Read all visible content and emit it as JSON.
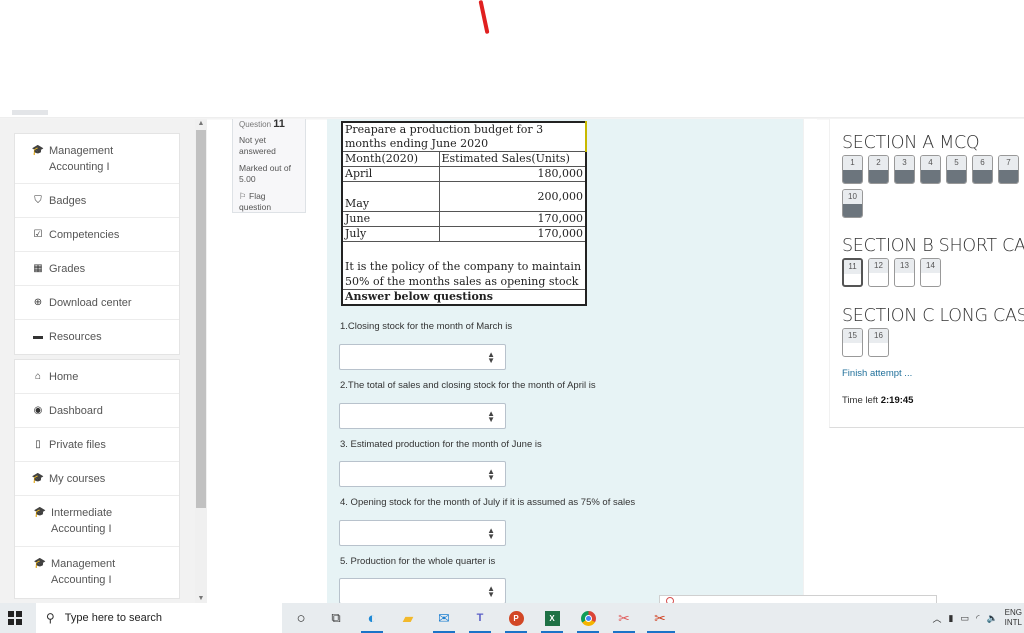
{
  "drawer": {
    "course_group": [
      {
        "icon": "graduation-cap-icon",
        "glyph": "🎓",
        "label": "Management Accounting I"
      },
      {
        "icon": "shield-icon",
        "glyph": "⛉",
        "label": "Badges"
      },
      {
        "icon": "checkbox-icon",
        "glyph": "☑",
        "label": "Competencies"
      },
      {
        "icon": "table-icon",
        "glyph": "▦",
        "label": "Grades"
      },
      {
        "icon": "download-icon",
        "glyph": "⊕",
        "label": "Download center"
      },
      {
        "icon": "archive-icon",
        "glyph": "▬",
        "label": "Resources"
      }
    ],
    "site_group": [
      {
        "icon": "home-icon",
        "glyph": "⌂",
        "label": "Home"
      },
      {
        "icon": "dashboard-icon",
        "glyph": "◉",
        "label": "Dashboard"
      },
      {
        "icon": "file-icon",
        "glyph": "▯",
        "label": "Private files"
      },
      {
        "icon": "graduation-cap-icon",
        "glyph": "🎓",
        "label": "My courses"
      },
      {
        "icon": "graduation-cap-icon",
        "glyph": "🎓",
        "label": "Intermediate Accounting I"
      },
      {
        "icon": "graduation-cap-icon",
        "glyph": "🎓",
        "label": "Management Accounting I"
      }
    ]
  },
  "question_info": {
    "question_label": "Question",
    "question_number": "11",
    "state": "Not yet answered",
    "marked_out_of": "Marked out of 5.00",
    "flag_label": "Flag question"
  },
  "budget_table": {
    "title": "Preapare a production budget for 3 months ending June 2020",
    "header_month": "Month(2020)",
    "header_sales": "Estimated Sales(Units)",
    "rows": [
      {
        "month": "April",
        "sales": "180,000"
      },
      {
        "month": "May",
        "sales": "200,000"
      },
      {
        "month": "June",
        "sales": "170,000"
      },
      {
        "month": "July",
        "sales": "170,000"
      }
    ],
    "policy": "It is the policy of the company to maintain 50% of the months sales as opening stock",
    "instruction": "Answer below questions"
  },
  "questions": [
    {
      "text": "1.Closing stock  for the month of March is",
      "selected": ""
    },
    {
      "text": "2.The total of sales and closing stock for the month of April is",
      "selected": ""
    },
    {
      "text": "3. Estimated production for the month of June is",
      "selected": ""
    },
    {
      "text": "4. Opening stock for the month of July if it is assumed as 75% of sales",
      "selected": ""
    },
    {
      "text": "5. Production for the whole quarter is",
      "selected": ""
    }
  ],
  "quiz_nav": {
    "sections": [
      {
        "title": "SECTION A MCQ",
        "questions": [
          {
            "n": "1",
            "answered": true
          },
          {
            "n": "2",
            "answered": true
          },
          {
            "n": "3",
            "answered": true
          },
          {
            "n": "4",
            "answered": true
          },
          {
            "n": "5",
            "answered": true
          },
          {
            "n": "6",
            "answered": true
          },
          {
            "n": "7",
            "answered": true
          },
          {
            "n": "10",
            "answered": true
          }
        ]
      },
      {
        "title": "SECTION B SHORT CAS",
        "questions": [
          {
            "n": "11",
            "answered": false,
            "current": true
          },
          {
            "n": "12",
            "answered": false
          },
          {
            "n": "13",
            "answered": false
          },
          {
            "n": "14",
            "answered": false
          }
        ]
      },
      {
        "title": "SECTION C LONG CAS",
        "questions": [
          {
            "n": "15",
            "answered": false
          },
          {
            "n": "16",
            "answered": false
          }
        ]
      }
    ],
    "finish_label": "Finish attempt ...",
    "time_left_label": "Time left",
    "time_left_value": "2:19:45"
  },
  "taskbar": {
    "search_placeholder": "Type here to search",
    "apps": [
      "cortana",
      "task-view",
      "edge",
      "file-explorer",
      "mail",
      "teams",
      "powerpoint",
      "excel",
      "chrome",
      "snipping-tool",
      "snip-and-sketch"
    ],
    "language_line1": "ENG",
    "language_line2": "INTL"
  }
}
